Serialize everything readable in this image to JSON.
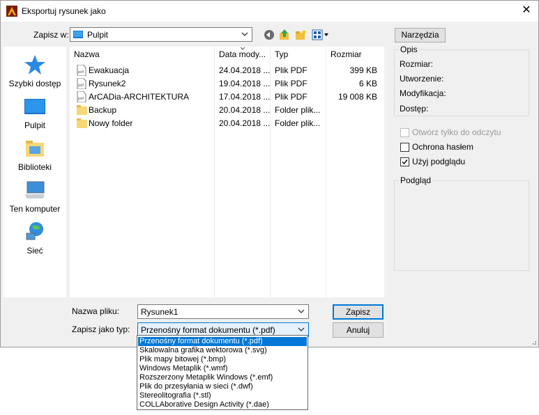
{
  "window": {
    "title": "Eksportuj rysunek jako",
    "close_glyph": "✕"
  },
  "save_in": {
    "label": "Zapisz w:",
    "value": "Pulpit"
  },
  "tools_button": "Narzędzia",
  "places": [
    {
      "label": "Szybki dostęp",
      "icon": "star-icon"
    },
    {
      "label": "Pulpit",
      "icon": "desktop-icon"
    },
    {
      "label": "Biblioteki",
      "icon": "libraries-icon"
    },
    {
      "label": "Ten komputer",
      "icon": "computer-icon"
    },
    {
      "label": "Sieć",
      "icon": "network-icon"
    }
  ],
  "columns": {
    "name": "Nazwa",
    "date": "Data mody...",
    "type": "Typ",
    "size": "Rozmiar"
  },
  "files": [
    {
      "name": "Ewakuacja",
      "date": "24.04.2018 ...",
      "type": "Plik PDF",
      "size": "399 KB",
      "icon": "pdf-file-icon"
    },
    {
      "name": "Rysunek2",
      "date": "19.04.2018 ...",
      "type": "Plik PDF",
      "size": "6 KB",
      "icon": "pdf-file-icon"
    },
    {
      "name": "ArCADia-ARCHITEKTURA",
      "date": "17.04.2018 ...",
      "type": "Plik PDF",
      "size": "19 008 KB",
      "icon": "pdf-file-icon"
    },
    {
      "name": "Backup",
      "date": "20.04.2018 ...",
      "type": "Folder plik...",
      "size": "",
      "icon": "folder-icon"
    },
    {
      "name": "Nowy folder",
      "date": "20.04.2018 ...",
      "type": "Folder plik...",
      "size": "",
      "icon": "folder-icon"
    }
  ],
  "description": {
    "title": "Opis",
    "size_label": "Rozmiar:",
    "created_label": "Utworzenie:",
    "modified_label": "Modyfikacja:",
    "access_label": "Dostęp:"
  },
  "options": {
    "read_only": {
      "label": "Otwórz tylko do odczytu",
      "checked": false,
      "enabled": false
    },
    "password": {
      "label": "Ochrona hasłem",
      "checked": false,
      "enabled": true
    },
    "preview": {
      "label": "Użyj podglądu",
      "checked": true,
      "enabled": true
    }
  },
  "preview_group": {
    "title": "Podgląd"
  },
  "filename": {
    "label": "Nazwa pliku:",
    "value": "Rysunek1"
  },
  "filetype": {
    "label": "Zapisz jako typ:",
    "value": "Przenośny format dokumentu (*.pdf)",
    "options": [
      "Przenośny format dokumentu (*.pdf)",
      "Skalowalna grafika wektorowa (*.svg)",
      "Plik mapy bitowej (*.bmp)",
      "Windows Metaplik (*.wmf)",
      "Rozszerzony Metaplik Windows (*.emf)",
      "Plik do przesyłania w sieci (*.dwf)",
      "Stereolitografia (*.stl)",
      "COLLAborative Design Activity (*.dae)"
    ],
    "selected_index": 0
  },
  "buttons": {
    "save": "Zapisz",
    "cancel": "Anuluj"
  },
  "colors": {
    "accent": "#0078d7",
    "folder": "#f8d775"
  }
}
